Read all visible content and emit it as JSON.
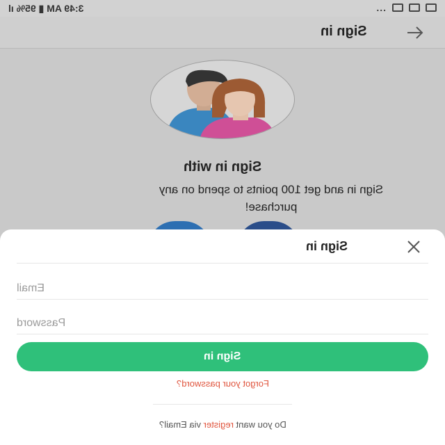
{
  "status_bar": {
    "time": "3:49 AM",
    "battery": "95%",
    "dots": "..."
  },
  "app_bar": {
    "title": "Sign in"
  },
  "hero": {
    "title": "Sign in with",
    "subtitle": "Sign in and get 100 points to spend on any purchase!"
  },
  "sheet": {
    "title": "Sign in",
    "email_placeholder": "Email",
    "password_placeholder": "Password",
    "signin_label": "Sign in",
    "forgot_label": "Forgot your password?",
    "register_prefix": "Do you want ",
    "register_link": "register",
    "register_suffix": " via Email?"
  },
  "colors": {
    "primary_green": "#2fc07a",
    "link_red": "#e0553e",
    "social_left": "#2d6fb2",
    "social_right": "#2a4d89"
  },
  "icons": [
    "signal-icon",
    "wifi-icon",
    "bluetooth-icon",
    "location-icon",
    "battery-icon",
    "arrow-right-icon",
    "close-icon"
  ]
}
